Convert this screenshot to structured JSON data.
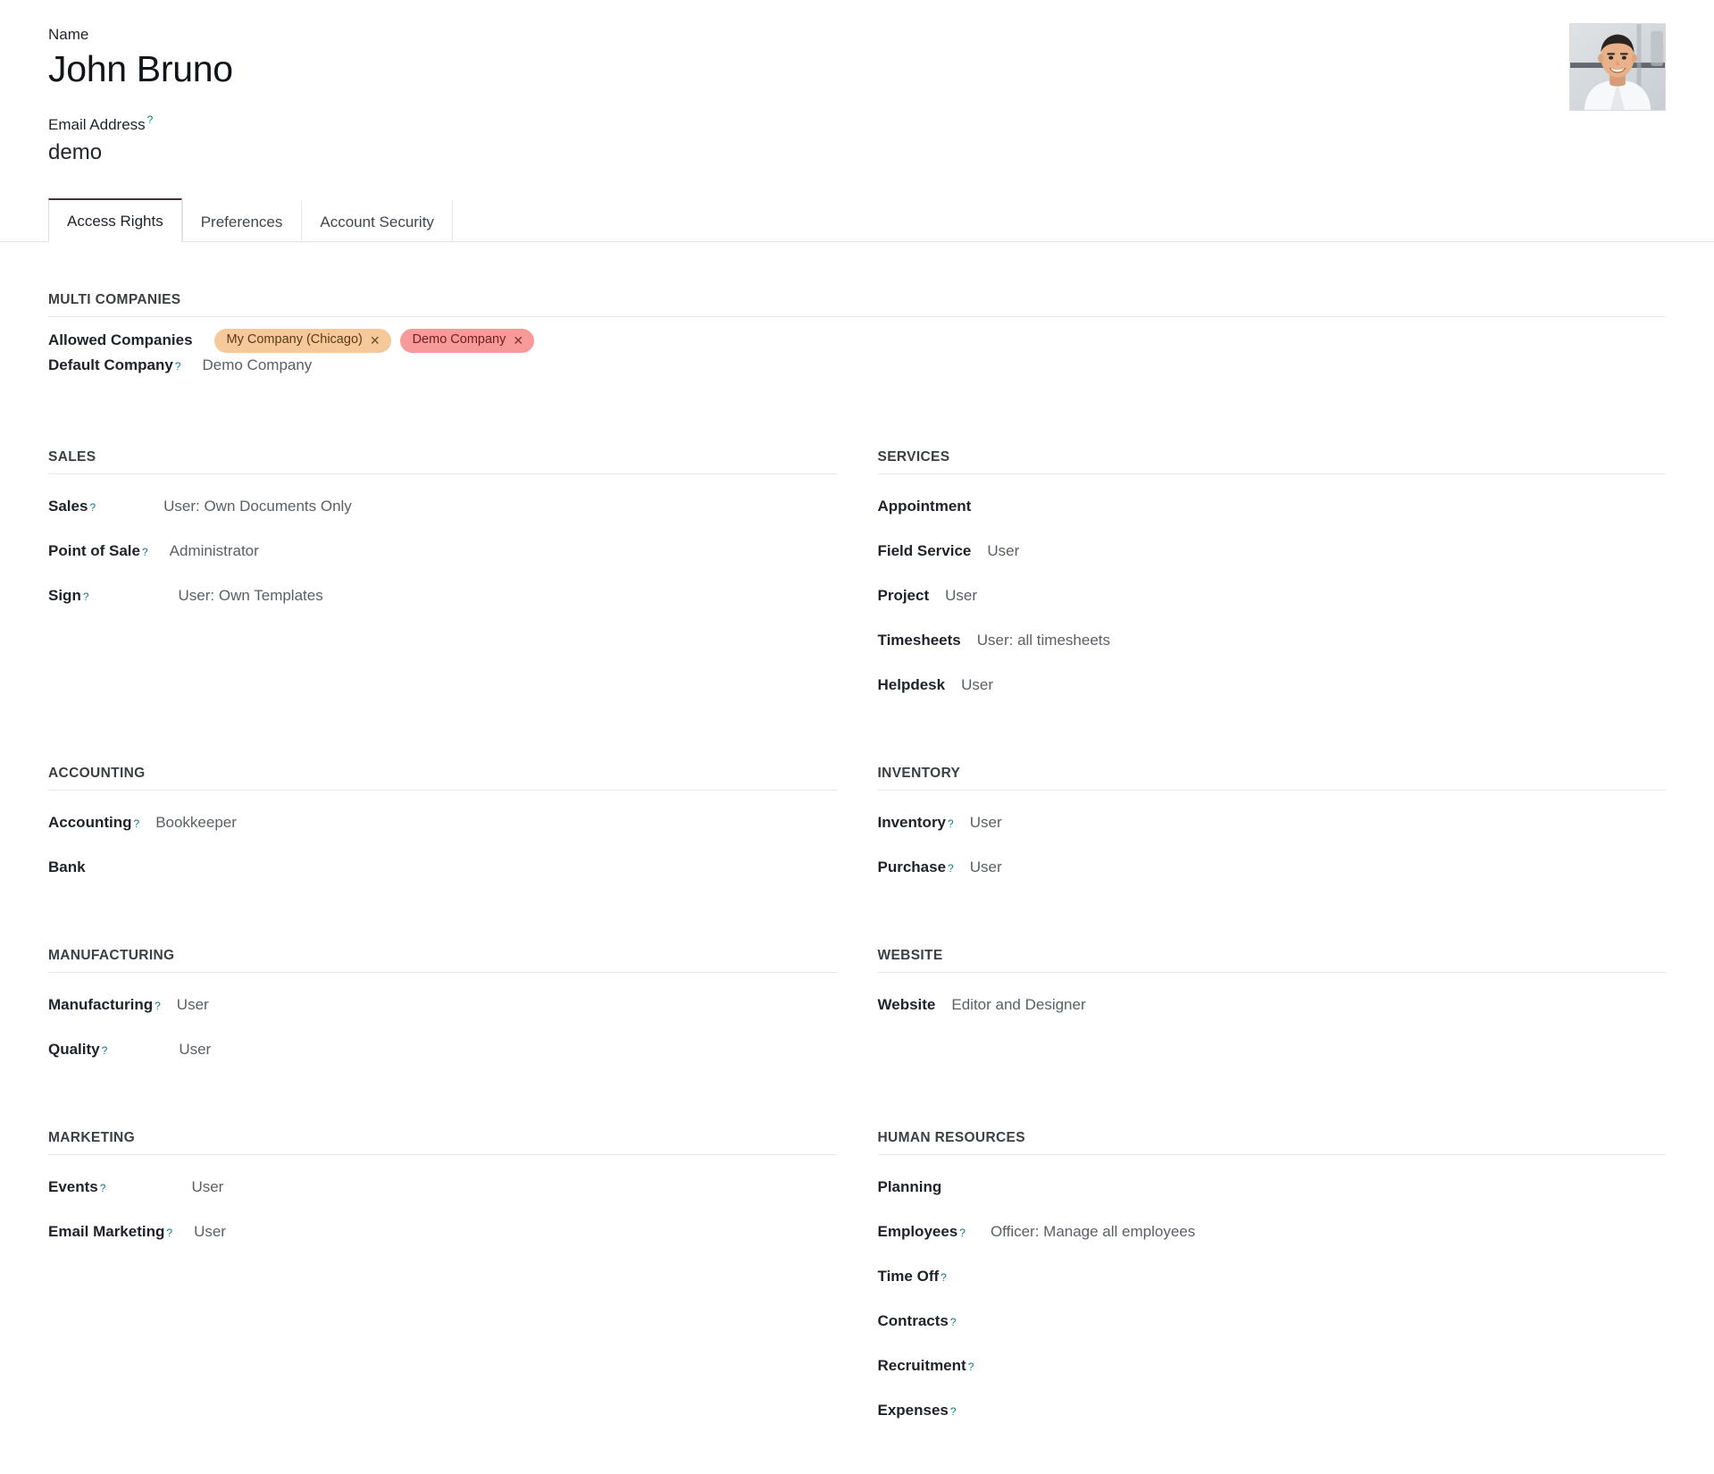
{
  "header": {
    "name_label": "Name",
    "name_value": "John Bruno",
    "email_label": "Email Address",
    "email_value": "demo",
    "help_glyph": "?",
    "avatar_alt": "user-avatar-photo"
  },
  "tabs": [
    {
      "label": "Access Rights",
      "active": true
    },
    {
      "label": "Preferences",
      "active": false
    },
    {
      "label": "Account Security",
      "active": false
    }
  ],
  "multi_companies": {
    "title": "MULTI COMPANIES",
    "allowed_label": "Allowed Companies",
    "tags": [
      {
        "label": "My Company (Chicago)",
        "bg": "#f5c99a",
        "fg": "#5a3b16",
        "close": "✕"
      },
      {
        "label": "Demo Company",
        "bg": "#f89a9a",
        "fg": "#6d1f1f",
        "close": "✕"
      }
    ],
    "default_label": "Default Company",
    "default_value": "Demo Company"
  },
  "sections": {
    "sales": {
      "title": "SALES",
      "rows": [
        {
          "label": "Sales",
          "help": true,
          "value": "User: Own Documents Only",
          "gap": 76
        },
        {
          "label": "Point of Sale",
          "help": true,
          "value": "Administrator",
          "gap": 24
        },
        {
          "label": "Sign",
          "help": true,
          "value": "User: Own Templates",
          "gap": 100
        }
      ]
    },
    "services": {
      "title": "SERVICES",
      "rows": [
        {
          "label": "Appointment",
          "help": false,
          "value": "",
          "gap": 0
        },
        {
          "label": "Field Service",
          "help": false,
          "value": "User",
          "gap": 18
        },
        {
          "label": "Project",
          "help": false,
          "value": "User",
          "gap": 18
        },
        {
          "label": "Timesheets",
          "help": false,
          "value": "User: all timesheets",
          "gap": 18
        },
        {
          "label": "Helpdesk",
          "help": false,
          "value": "User",
          "gap": 18
        }
      ]
    },
    "accounting": {
      "title": "ACCOUNTING",
      "rows": [
        {
          "label": "Accounting",
          "help": true,
          "value": "Bookkeeper",
          "gap": 18
        },
        {
          "label": "Bank",
          "help": false,
          "value": "",
          "gap": 0
        }
      ]
    },
    "inventory": {
      "title": "INVENTORY",
      "rows": [
        {
          "label": "Inventory",
          "help": true,
          "value": "User",
          "gap": 18
        },
        {
          "label": "Purchase",
          "help": true,
          "value": "User",
          "gap": 18
        }
      ]
    },
    "manufacturing": {
      "title": "MANUFACTURING",
      "rows": [
        {
          "label": "Manufacturing",
          "help": true,
          "value": "User",
          "gap": 18
        },
        {
          "label": "Quality",
          "help": true,
          "value": "User",
          "gap": 80
        }
      ]
    },
    "website": {
      "title": "WEBSITE",
      "rows": [
        {
          "label": "Website",
          "help": false,
          "value": "Editor and Designer",
          "gap": 18
        }
      ]
    },
    "marketing": {
      "title": "MARKETING",
      "rows": [
        {
          "label": "Events",
          "help": true,
          "value": "User",
          "gap": 96
        },
        {
          "label": "Email Marketing",
          "help": true,
          "value": "User",
          "gap": 24
        }
      ]
    },
    "human_resources": {
      "title": "HUMAN RESOURCES",
      "rows": [
        {
          "label": "Planning",
          "help": false,
          "value": "",
          "gap": 0
        },
        {
          "label": "Employees",
          "help": true,
          "value": "Officer: Manage all employees",
          "gap": 28
        },
        {
          "label": "Time Off",
          "help": true,
          "value": "",
          "gap": 0
        },
        {
          "label": "Contracts",
          "help": true,
          "value": "",
          "gap": 0
        },
        {
          "label": "Recruitment",
          "help": true,
          "value": "",
          "gap": 0
        },
        {
          "label": "Expenses",
          "help": true,
          "value": "",
          "gap": 0
        }
      ]
    }
  }
}
